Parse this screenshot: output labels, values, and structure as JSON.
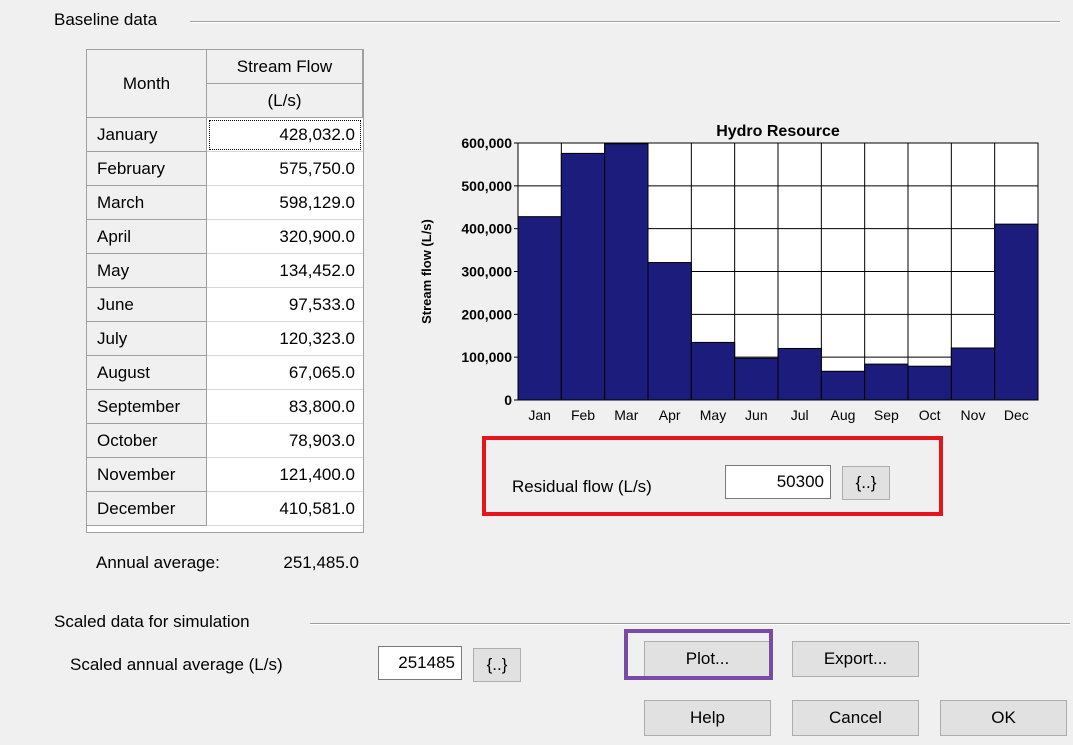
{
  "baseline": {
    "group_label": "Baseline data",
    "columns": {
      "month": "Month",
      "flow": "Stream Flow",
      "flow_unit": "(L/s)"
    },
    "rows": [
      {
        "month": "January",
        "flow": "428,032.0"
      },
      {
        "month": "February",
        "flow": "575,750.0"
      },
      {
        "month": "March",
        "flow": "598,129.0"
      },
      {
        "month": "April",
        "flow": "320,900.0"
      },
      {
        "month": "May",
        "flow": "134,452.0"
      },
      {
        "month": "June",
        "flow": "97,533.0"
      },
      {
        "month": "July",
        "flow": "120,323.0"
      },
      {
        "month": "August",
        "flow": "67,065.0"
      },
      {
        "month": "September",
        "flow": "83,800.0"
      },
      {
        "month": "October",
        "flow": "78,903.0"
      },
      {
        "month": "November",
        "flow": "121,400.0"
      },
      {
        "month": "December",
        "flow": "410,581.0"
      }
    ],
    "annual_label": "Annual average:",
    "annual_value": "251,485.0"
  },
  "residual": {
    "label": "Residual flow (L/s)",
    "value": "50300",
    "button": "{..}"
  },
  "scaled": {
    "group_label": "Scaled data for simulation",
    "label": "Scaled annual average (L/s)",
    "value": "251485",
    "button": "{..}"
  },
  "buttons": {
    "plot": "Plot...",
    "export": "Export...",
    "help": "Help",
    "cancel": "Cancel",
    "ok": "OK"
  },
  "colors": {
    "bar": "#1c1c7c",
    "highlight_residual": "#e8141c",
    "highlight_plot": "#7a4aa8"
  },
  "chart_data": {
    "type": "bar",
    "title": "Hydro Resource",
    "ylabel": "Stream flow (L/s)",
    "xlabel": "",
    "categories": [
      "Jan",
      "Feb",
      "Mar",
      "Apr",
      "May",
      "Jun",
      "Jul",
      "Aug",
      "Sep",
      "Oct",
      "Nov",
      "Dec"
    ],
    "values": [
      428032,
      575750,
      598129,
      320900,
      134452,
      97533,
      120323,
      67065,
      83800,
      78903,
      121400,
      410581
    ],
    "ylim": [
      0,
      600000
    ],
    "yticks": [
      "0",
      "100,000",
      "200,000",
      "300,000",
      "400,000",
      "500,000",
      "600,000"
    ],
    "grid": true,
    "legend": "none"
  }
}
